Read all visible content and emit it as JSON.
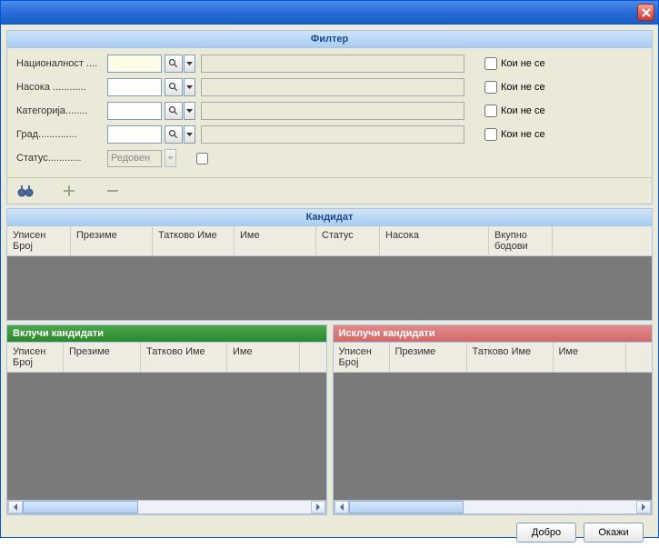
{
  "titlebar": {
    "close": "×"
  },
  "filter": {
    "title": "Филтер",
    "rows": [
      {
        "label": "Националност ....",
        "checkbox": "Кои не се"
      },
      {
        "label": "Насока ............",
        "checkbox": "Кои не се"
      },
      {
        "label": "Категорија........",
        "checkbox": "Кои не се"
      },
      {
        "label": "Град..............",
        "checkbox": "Кои не се"
      }
    ],
    "status_label": "Статус............",
    "status_value": "Редовен"
  },
  "candidate": {
    "title": "Кандидат",
    "cols": [
      "Уписен Број",
      "Презиме",
      "Татково Име",
      "Име",
      "Статус",
      "Насока",
      "Вкупно бодови"
    ]
  },
  "include": {
    "title": "Вклучи кандидати",
    "cols": [
      "Уписен Број",
      "Презиме",
      "Татково Име",
      "Име"
    ]
  },
  "exclude": {
    "title": "Исклучи кандидати",
    "cols": [
      "Уписен Број",
      "Презиме",
      "Татково Име",
      "Име"
    ]
  },
  "buttons": {
    "ok": "Добро",
    "show": "Окажи"
  }
}
